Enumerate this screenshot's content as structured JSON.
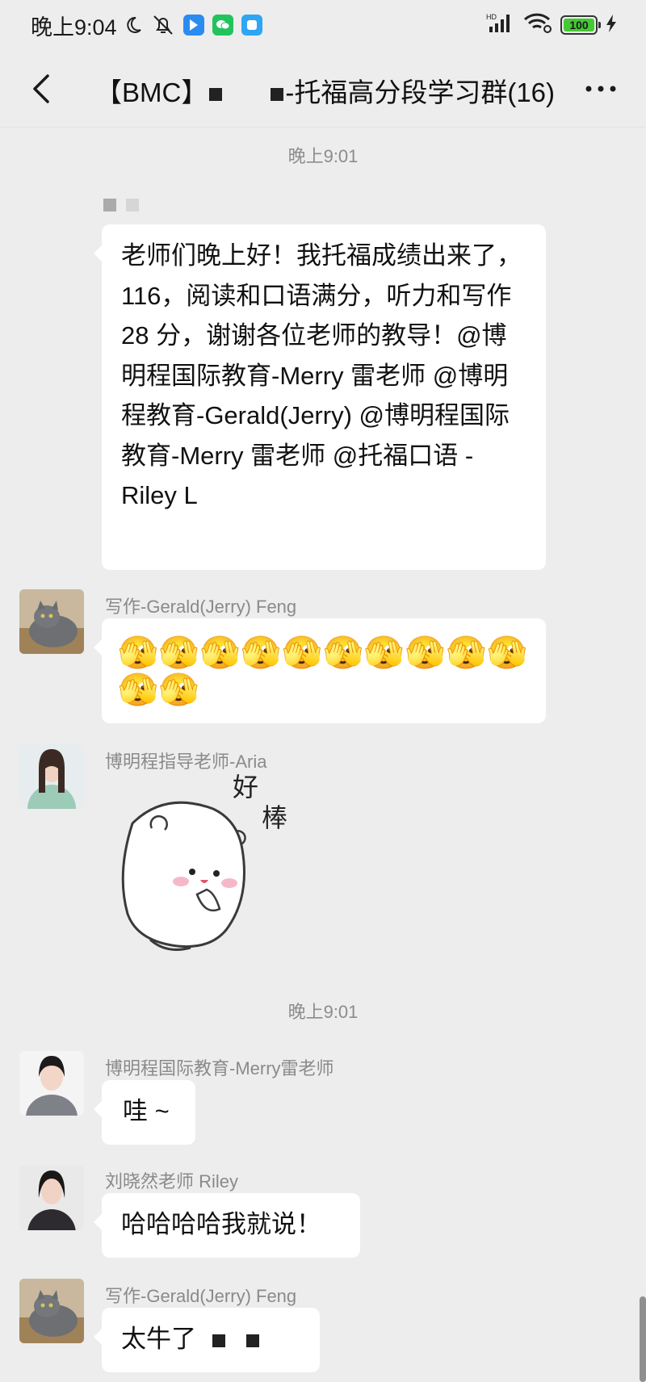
{
  "status_bar": {
    "time": "晚上9:04",
    "network": "HD",
    "battery": "100"
  },
  "header": {
    "title_prefix": "【BMC】",
    "title_suffix": "-托福高分段学习群(16)"
  },
  "messages": [
    {
      "type": "time",
      "text": "晚上9:01"
    },
    {
      "type": "text",
      "sender": "",
      "text": "老师们晚上好！我托福成绩出来了，116，阅读和口语满分，听力和写作 28 分，谢谢各位老师的教导！@博明程国际教育-Merry 雷老师 @博明程教育-Gerald(Jerry) @博明程国际教育-Merry 雷老师 @托福口语 - Riley L"
    },
    {
      "type": "emoji",
      "sender": "写作-Gerald(Jerry) Feng",
      "text": "🫣🫣🫣🫣🫣🫣🫣🫣🫣🫣🫣🫣"
    },
    {
      "type": "sticker",
      "sender": "博明程指导老师-Aria",
      "text": "好棒"
    },
    {
      "type": "time",
      "text": "晚上9:01"
    },
    {
      "type": "text",
      "sender": "博明程国际教育-Merry雷老师",
      "text": "哇 ~"
    },
    {
      "type": "text",
      "sender": "刘晓然老师 Riley",
      "text": "哈哈哈哈我就说！"
    },
    {
      "type": "text",
      "sender": "写作-Gerald(Jerry) Feng",
      "text": "太牛了"
    }
  ]
}
